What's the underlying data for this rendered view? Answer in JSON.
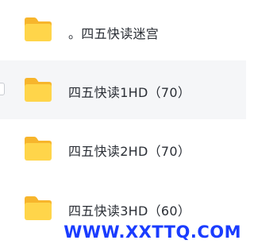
{
  "files": [
    {
      "name": "。四五快读迷宫",
      "type": "folder",
      "icon": "folder-icon"
    },
    {
      "name": "四五快读1HD（70）",
      "type": "folder",
      "icon": "folder-icon"
    },
    {
      "name": "四五快读2HD（70）",
      "type": "folder",
      "icon": "folder-icon"
    },
    {
      "name": "四五快读3HD（60）",
      "type": "folder",
      "icon": "folder-icon"
    }
  ],
  "watermark": "WWW.XXTTQ.COM",
  "colors": {
    "folder_body": "#FFD54A",
    "folder_tab": "#F7B52C",
    "hover_bg": "#F5F6F8",
    "text": "#2B2F36",
    "watermark": "#1A3CFF"
  }
}
